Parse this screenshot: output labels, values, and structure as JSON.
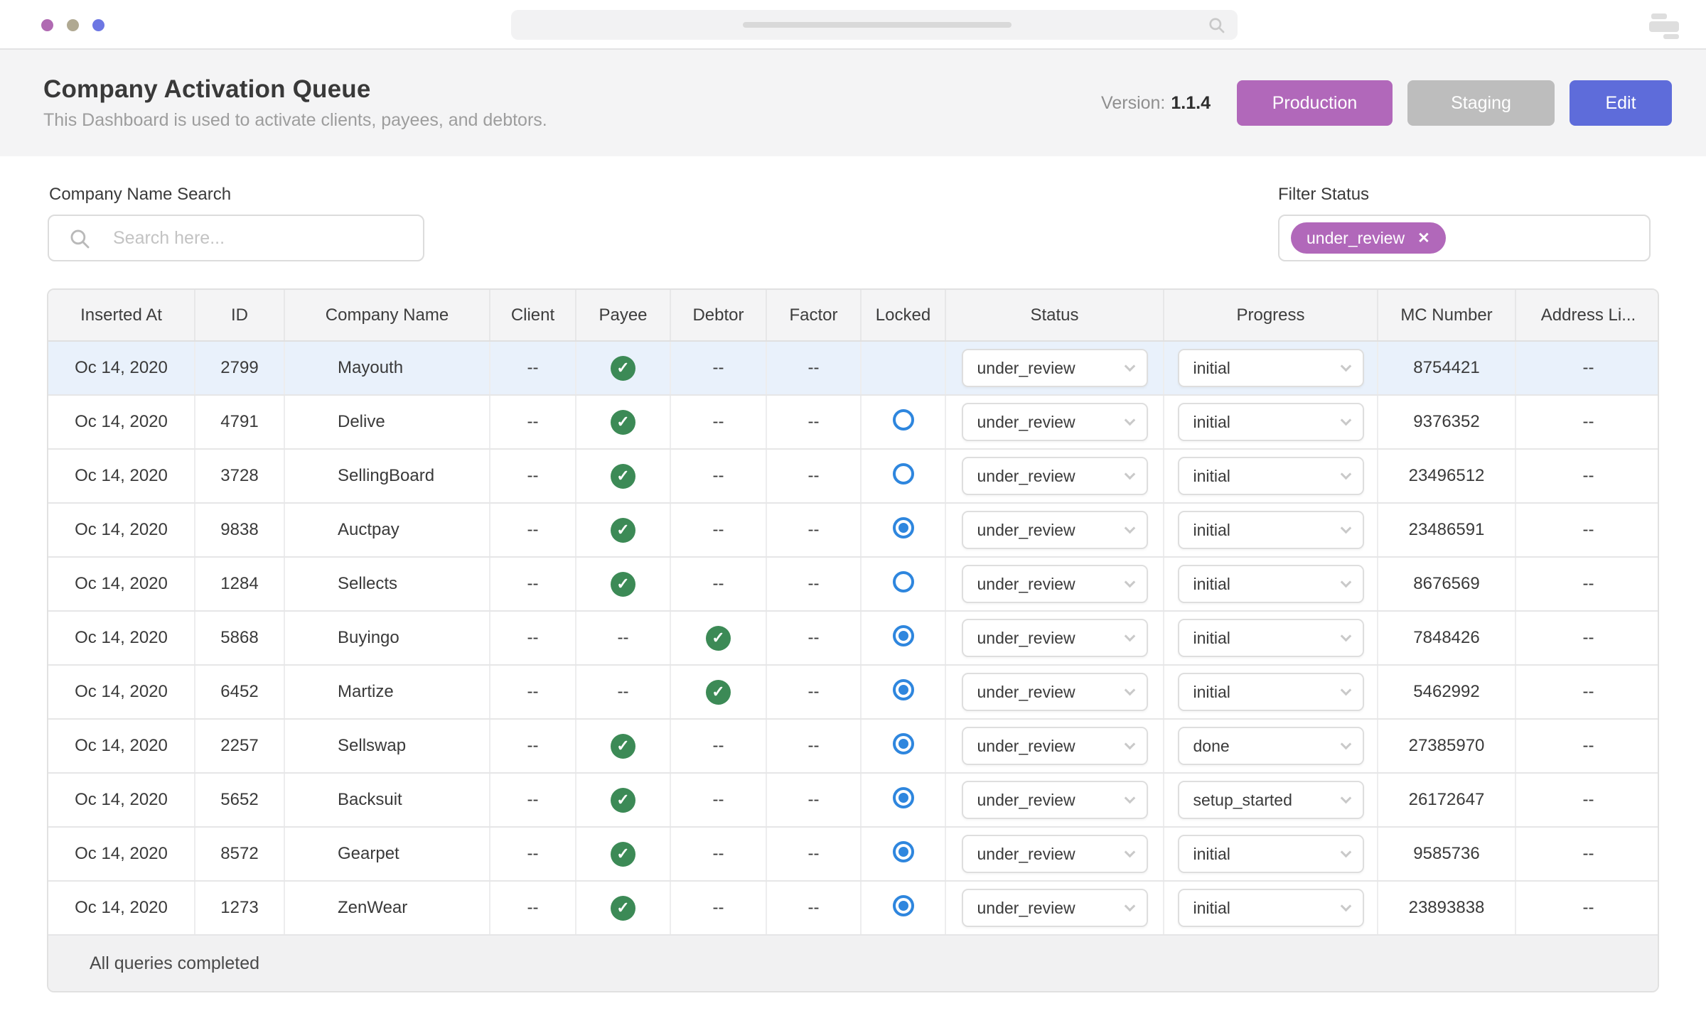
{
  "colors": {
    "accent_purple": "#b168ba",
    "accent_gray": "#bdbdbd",
    "accent_blue": "#5e6cda",
    "check_green": "#3c8a56",
    "radio_blue": "#2e86de",
    "selected_row_bg": "#e9f1fb",
    "window_dot_1": "#b06ab2",
    "window_dot_2": "#b0a992",
    "window_dot_3": "#6d77e3"
  },
  "header": {
    "title": "Company Activation Queue",
    "subtitle": "This Dashboard is used to activate clients, payees, and debtors.",
    "version_label": "Version:",
    "version_value": "1.1.4",
    "buttons": {
      "production": "Production",
      "staging": "Staging",
      "edit": "Edit"
    }
  },
  "filters": {
    "search_label": "Company Name Search",
    "search_placeholder": "Search here...",
    "search_value": "",
    "filter_label": "Filter Status",
    "chip_label": "under_review"
  },
  "table": {
    "columns": [
      "Inserted At",
      "ID",
      "Company Name",
      "Client",
      "Payee",
      "Debtor",
      "Factor",
      "Locked",
      "Status",
      "Progress",
      "MC Number",
      "Address Li..."
    ],
    "rows": [
      {
        "inserted_at": "Oc 14, 2020",
        "id": "2799",
        "company": "Mayouth",
        "client": "--",
        "payee": "check",
        "debtor": "--",
        "factor": "--",
        "locked": "none",
        "status": "under_review",
        "progress": "initial",
        "mc_number": "8754421",
        "address": "--",
        "selected": true
      },
      {
        "inserted_at": "Oc 14, 2020",
        "id": "4791",
        "company": "Delive",
        "client": "--",
        "payee": "check",
        "debtor": "--",
        "factor": "--",
        "locked": "open",
        "status": "under_review",
        "progress": "initial",
        "mc_number": "9376352",
        "address": "--",
        "selected": false
      },
      {
        "inserted_at": "Oc 14, 2020",
        "id": "3728",
        "company": "SellingBoard",
        "client": "--",
        "payee": "check",
        "debtor": "--",
        "factor": "--",
        "locked": "open",
        "status": "under_review",
        "progress": "initial",
        "mc_number": "23496512",
        "address": "--",
        "selected": false
      },
      {
        "inserted_at": "Oc 14, 2020",
        "id": "9838",
        "company": "Auctpay",
        "client": "--",
        "payee": "check",
        "debtor": "--",
        "factor": "--",
        "locked": "filled",
        "status": "under_review",
        "progress": "initial",
        "mc_number": "23486591",
        "address": "--",
        "selected": false
      },
      {
        "inserted_at": "Oc 14, 2020",
        "id": "1284",
        "company": "Sellects",
        "client": "--",
        "payee": "check",
        "debtor": "--",
        "factor": "--",
        "locked": "open",
        "status": "under_review",
        "progress": "initial",
        "mc_number": "8676569",
        "address": "--",
        "selected": false
      },
      {
        "inserted_at": "Oc 14, 2020",
        "id": "5868",
        "company": "Buyingo",
        "client": "--",
        "payee": "--",
        "debtor": "check",
        "factor": "--",
        "locked": "filled",
        "status": "under_review",
        "progress": "initial",
        "mc_number": "7848426",
        "address": "--",
        "selected": false
      },
      {
        "inserted_at": "Oc 14, 2020",
        "id": "6452",
        "company": "Martize",
        "client": "--",
        "payee": "--",
        "debtor": "check",
        "factor": "--",
        "locked": "filled",
        "status": "under_review",
        "progress": "initial",
        "mc_number": "5462992",
        "address": "--",
        "selected": false
      },
      {
        "inserted_at": "Oc 14, 2020",
        "id": "2257",
        "company": "Sellswap",
        "client": "--",
        "payee": "check",
        "debtor": "--",
        "factor": "--",
        "locked": "filled",
        "status": "under_review",
        "progress": "done",
        "mc_number": "27385970",
        "address": "--",
        "selected": false
      },
      {
        "inserted_at": "Oc 14, 2020",
        "id": "5652",
        "company": "Backsuit",
        "client": "--",
        "payee": "check",
        "debtor": "--",
        "factor": "--",
        "locked": "filled",
        "status": "under_review",
        "progress": "setup_started",
        "mc_number": "26172647",
        "address": "--",
        "selected": false
      },
      {
        "inserted_at": "Oc 14, 2020",
        "id": "8572",
        "company": "Gearpet",
        "client": "--",
        "payee": "check",
        "debtor": "--",
        "factor": "--",
        "locked": "filled",
        "status": "under_review",
        "progress": "initial",
        "mc_number": "9585736",
        "address": "--",
        "selected": false
      },
      {
        "inserted_at": "Oc 14, 2020",
        "id": "1273",
        "company": "ZenWear",
        "client": "--",
        "payee": "check",
        "debtor": "--",
        "factor": "--",
        "locked": "filled",
        "status": "under_review",
        "progress": "initial",
        "mc_number": "23893838",
        "address": "--",
        "selected": false
      }
    ],
    "footer": "All queries completed"
  }
}
